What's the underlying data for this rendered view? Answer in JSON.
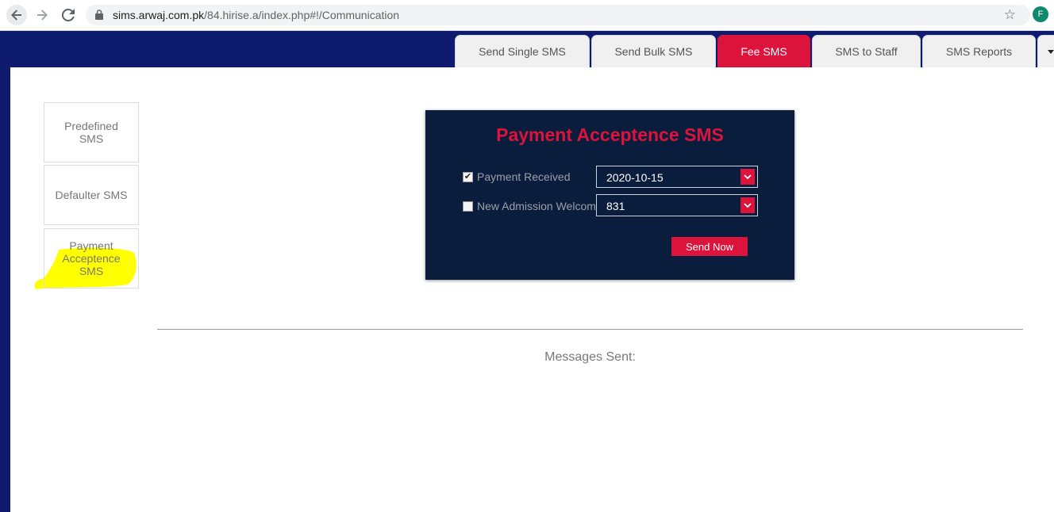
{
  "browser": {
    "url_host": "sims.arwaj.com.pk",
    "url_path": "/84.hirise.a/index.php#!/Communication",
    "profile_initial": "F"
  },
  "tabs": [
    {
      "label": "Send Single SMS",
      "active": false
    },
    {
      "label": "Send Bulk SMS",
      "active": false
    },
    {
      "label": "Fee SMS",
      "active": true
    },
    {
      "label": "SMS to Staff",
      "active": false
    },
    {
      "label": "SMS Reports",
      "active": false
    }
  ],
  "sidebar": {
    "items": [
      {
        "label": "Predefined SMS"
      },
      {
        "label": "Defaulter SMS"
      },
      {
        "label": "Payment Acceptence SMS",
        "highlighted": true
      }
    ]
  },
  "panel": {
    "title": "Payment Acceptence SMS",
    "payment_received_label": "Payment Received",
    "payment_received_checked": true,
    "payment_date": "2020-10-15",
    "new_admission_label": "New Admission Welcome",
    "new_admission_checked": false,
    "admission_value": "831",
    "send_label": "Send Now"
  },
  "messages_sent_label": "Messages Sent:",
  "colors": {
    "navy_header": "#0e1b6e",
    "panel_bg": "#0b1d3c",
    "accent_red": "#dc143c",
    "highlight_yellow": "#ffff00"
  }
}
